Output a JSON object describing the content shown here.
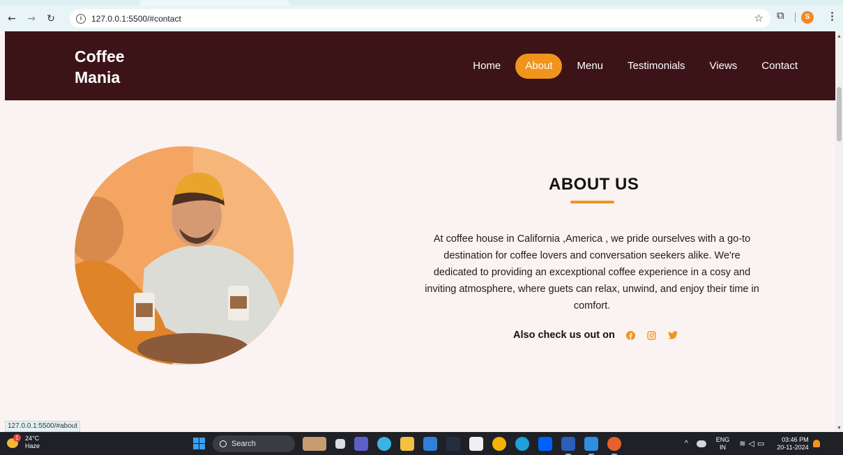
{
  "browser": {
    "url": "127.0.0.1:5500/#contact",
    "profile_initial": "S",
    "status_url": "127.0.0.1:5500/#about"
  },
  "site": {
    "logo_line1": "Coffee",
    "logo_line2": "Mania",
    "nav": [
      {
        "label": "Home"
      },
      {
        "label": "About"
      },
      {
        "label": "Menu"
      },
      {
        "label": "Testimonials"
      },
      {
        "label": "Views"
      },
      {
        "label": "Contact"
      }
    ],
    "accent_color": "#f0941c",
    "header_color": "#3c1418"
  },
  "about": {
    "title": "ABOUT US",
    "body": "At coffee house in California ,America , we pride ourselves with a go-to destination for coffee lovers and conversation seekers alike. We're dedicated to providing an excexptional coffee experience in a cosy and inviting atmosphere, where guets can relax, unwind, and enjoy their time in comfort.",
    "social_label": "Also check us out on",
    "social_icons": [
      "facebook-icon",
      "instagram-icon",
      "twitter-icon"
    ]
  },
  "taskbar": {
    "weather_badge": "1",
    "temperature": "24°C",
    "condition": "Haze",
    "search_label": "Search",
    "lang_line1": "ENG",
    "lang_line2": "IN",
    "time": "03:46 PM",
    "date": "20-11-2024"
  }
}
